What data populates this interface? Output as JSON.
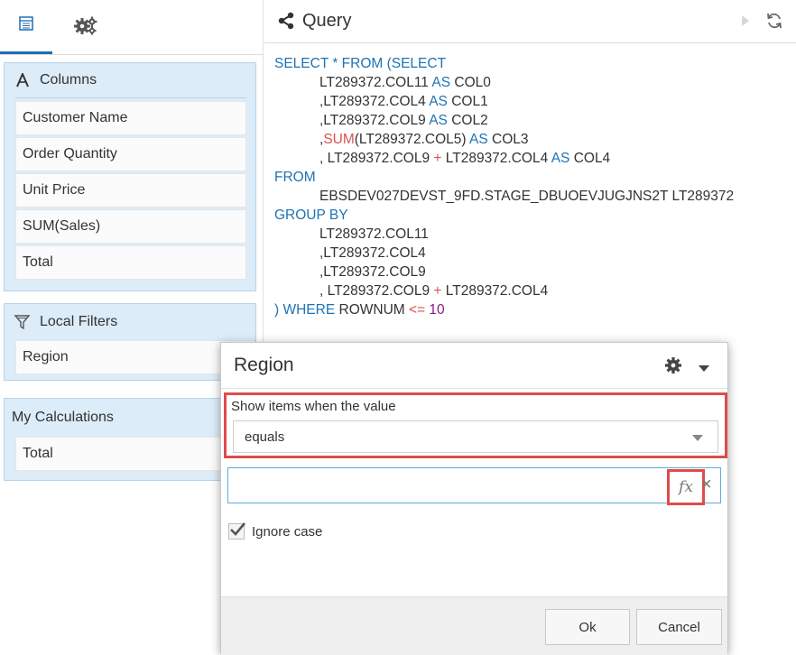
{
  "left": {
    "tabs": [
      {
        "name": "data-tab",
        "icon": "table-icon",
        "active": true
      },
      {
        "name": "settings-tab",
        "icon": "gears-icon",
        "active": false
      }
    ],
    "columns": {
      "title": "Columns",
      "items": [
        "Customer Name",
        "Order Quantity",
        "Unit Price",
        "SUM(Sales)",
        "Total"
      ]
    },
    "filters": {
      "title": "Local Filters",
      "items": [
        "Region"
      ]
    },
    "calculations": {
      "title": "My Calculations",
      "items": [
        "Total"
      ]
    }
  },
  "query": {
    "title": "Query",
    "sql": {
      "l1_a": "SELECT * FROM (SELECT",
      "l2": "LT289372.COL11",
      "as": "AS",
      "col0": "COL0",
      "l3": ",LT289372.COL4",
      "col1": "COL1",
      "l4": ",LT289372.COL9",
      "col2": "COL2",
      "l5_pre": ",",
      "sum": "SUM",
      "l5_arg": "(LT289372.COL5)",
      "col3": "COL3",
      "l6_a": ", LT289372.COL9",
      "plus": "+",
      "l6_b": "LT289372.COL4",
      "col4": "COL4",
      "from": "FROM",
      "table": "EBSDEV027DEVST_9FD.STAGE_DBUOEVJUGJNS2T LT289372",
      "groupby": "GROUP BY",
      "g1": "LT289372.COL11",
      "g2": ",LT289372.COL4",
      "g3": ",LT289372.COL9",
      "g4_a": ", LT289372.COL9",
      "g4_b": "LT289372.COL4",
      "close": ")",
      "where": "WHERE",
      "rownum": "ROWNUM",
      "lte": "<=",
      "limit": "10"
    }
  },
  "dialog": {
    "title": "Region",
    "condition_label": "Show items when the value",
    "condition_value": "equals",
    "value_input": "",
    "fx_label": "fx",
    "clear_label": "×",
    "ignore_case_label": "Ignore case",
    "ignore_case_checked": true,
    "ok_label": "Ok",
    "cancel_label": "Cancel",
    "highlight_color": "#e04b4b"
  }
}
